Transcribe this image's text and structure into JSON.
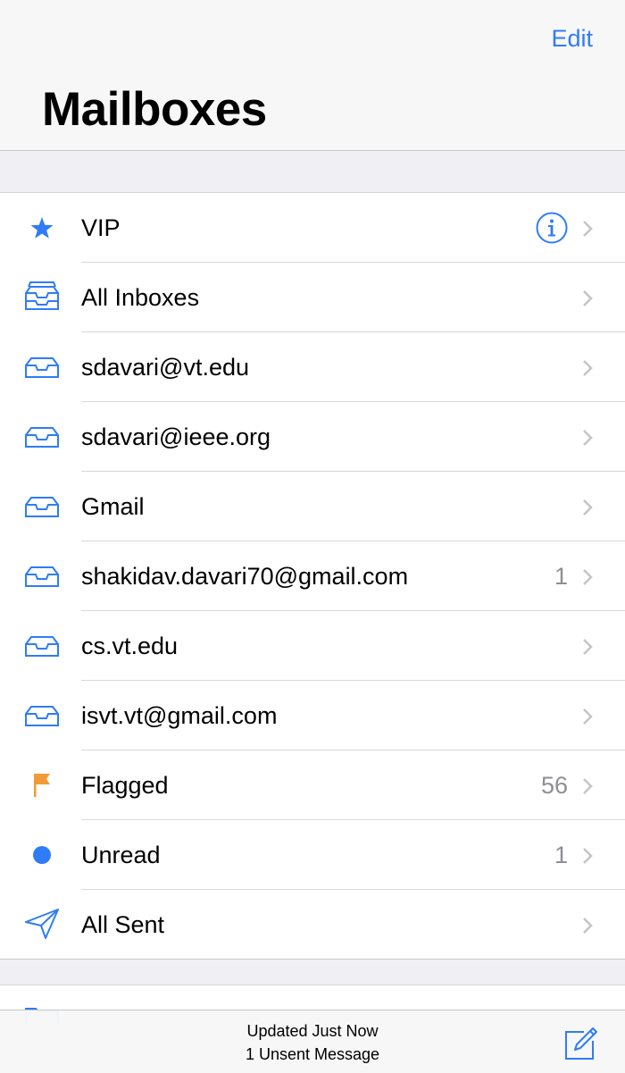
{
  "nav": {
    "edit_label": "Edit",
    "title": "Mailboxes"
  },
  "mailboxes": [
    {
      "label": "VIP",
      "icon": "star-icon",
      "count": "",
      "info": true
    },
    {
      "label": "All Inboxes",
      "icon": "inboxes-icon",
      "count": ""
    },
    {
      "label": "sdavari@vt.edu",
      "icon": "tray-icon",
      "count": ""
    },
    {
      "label": "sdavari@ieee.org",
      "icon": "tray-icon",
      "count": ""
    },
    {
      "label": "Gmail",
      "icon": "tray-icon",
      "count": ""
    },
    {
      "label": "shakidav.davari70@gmail.com",
      "icon": "tray-icon",
      "count": "1"
    },
    {
      "label": "cs.vt.edu",
      "icon": "tray-icon",
      "count": ""
    },
    {
      "label": "isvt.vt@gmail.com",
      "icon": "tray-icon",
      "count": ""
    },
    {
      "label": "Flagged",
      "icon": "flag-icon",
      "count": "56"
    },
    {
      "label": "Unread",
      "icon": "unread-dot-icon",
      "count": "1"
    },
    {
      "label": "All Sent",
      "icon": "paper-plane-icon",
      "count": ""
    }
  ],
  "toolbar": {
    "status_line1": "Updated Just Now",
    "status_line2": "1 Unsent Message"
  },
  "colors": {
    "accent": "#2f7cf6",
    "flag": "#f19a37",
    "count": "#8e8e93"
  }
}
